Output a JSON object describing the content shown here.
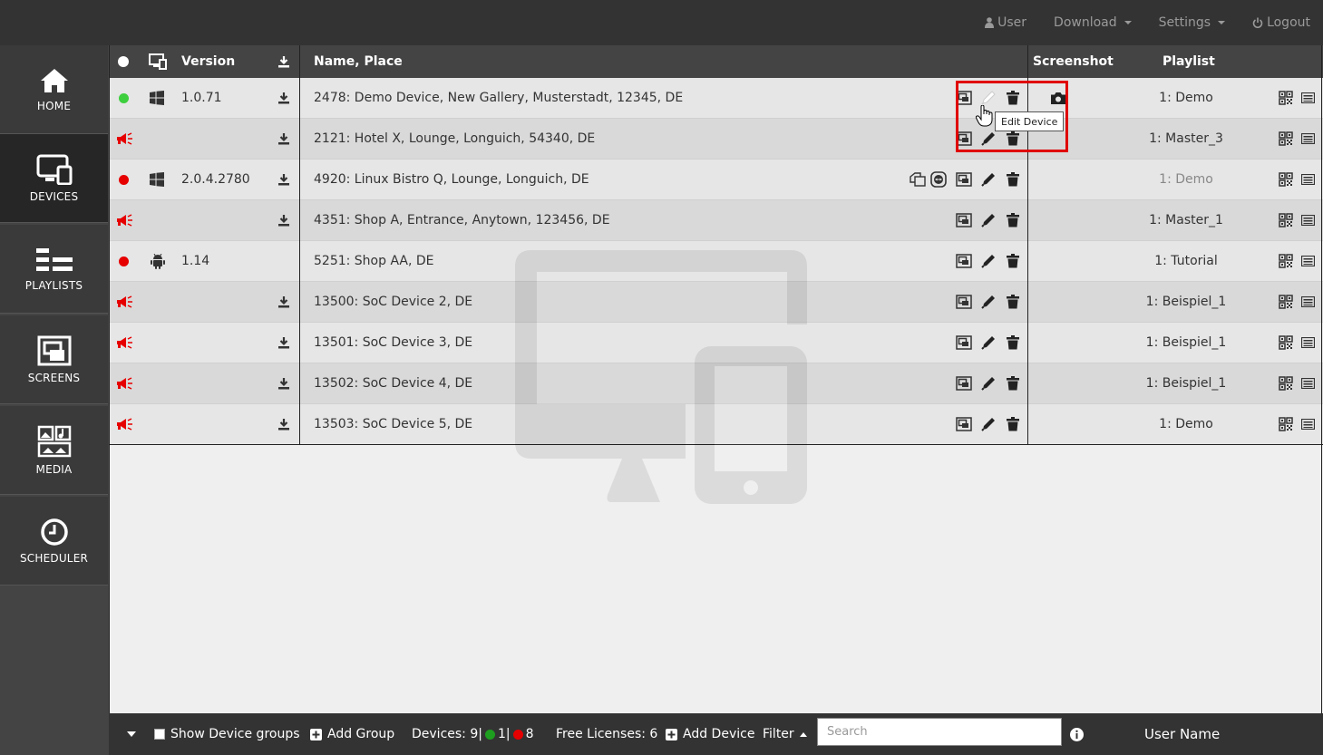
{
  "topnav": {
    "user": "User",
    "download": "Download",
    "settings": "Settings",
    "logout": "Logout"
  },
  "sidebar": {
    "items": [
      {
        "label": "HOME",
        "icon": "home-icon"
      },
      {
        "label": "DEVICES",
        "icon": "devices-icon"
      },
      {
        "label": "PLAYLISTS",
        "icon": "playlists-icon"
      },
      {
        "label": "SCREENS",
        "icon": "screens-icon"
      },
      {
        "label": "MEDIA",
        "icon": "media-icon"
      },
      {
        "label": "SCHEDULER",
        "icon": "clock-icon"
      }
    ]
  },
  "table": {
    "headers": {
      "version": "Version",
      "name_place": "Name, Place",
      "screenshot": "Screenshot",
      "playlist": "Playlist"
    },
    "rows": [
      {
        "status": "green",
        "os": "windows",
        "version": "1.0.71",
        "name": "2478: Demo Device, New Gallery, Musterstadt, 12345, DE",
        "playlist": "1: Demo"
      },
      {
        "status": "alert",
        "os": "",
        "version": "",
        "name": "2121: Hotel X, Lounge, Longuich, 54340, DE",
        "playlist": "1: Master_3"
      },
      {
        "status": "red",
        "os": "windows",
        "version": "2.0.4.2780",
        "name": "4920: Linux Bistro Q, Lounge, Longuich, DE",
        "playlist": "1: Demo"
      },
      {
        "status": "alert",
        "os": "",
        "version": "",
        "name": "4351: Shop A, Entrance, Anytown, 123456, DE",
        "playlist": "1: Master_1"
      },
      {
        "status": "red",
        "os": "android",
        "version": "1.14",
        "name": "5251: Shop AA, DE",
        "playlist": "1: Tutorial"
      },
      {
        "status": "alert",
        "os": "",
        "version": "",
        "name": "13500: SoC Device 2, DE",
        "playlist": "1: Beispiel_1"
      },
      {
        "status": "alert",
        "os": "",
        "version": "",
        "name": "13501: SoC Device 3, DE",
        "playlist": "1: Beispiel_1"
      },
      {
        "status": "alert",
        "os": "",
        "version": "",
        "name": "13502: SoC Device 4, DE",
        "playlist": "1: Beispiel_1"
      },
      {
        "status": "alert",
        "os": "",
        "version": "",
        "name": "13503: SoC Device 5, DE",
        "playlist": "1: Demo"
      }
    ]
  },
  "tooltip": "Edit Device",
  "footer": {
    "show_groups": "Show Device groups",
    "add_group": "Add Group",
    "devices_label": "Devices: 9|",
    "online_count": "1|",
    "offline_count": "8",
    "free_licenses": "Free Licenses: 6",
    "add_device": "Add Device",
    "filter": "Filter",
    "search_placeholder": "Search",
    "user_name": "User Name"
  },
  "colors": {
    "online": "#3ecf3e",
    "offline": "#e60000",
    "alert": "#e60000",
    "highlight": "#e00000"
  }
}
